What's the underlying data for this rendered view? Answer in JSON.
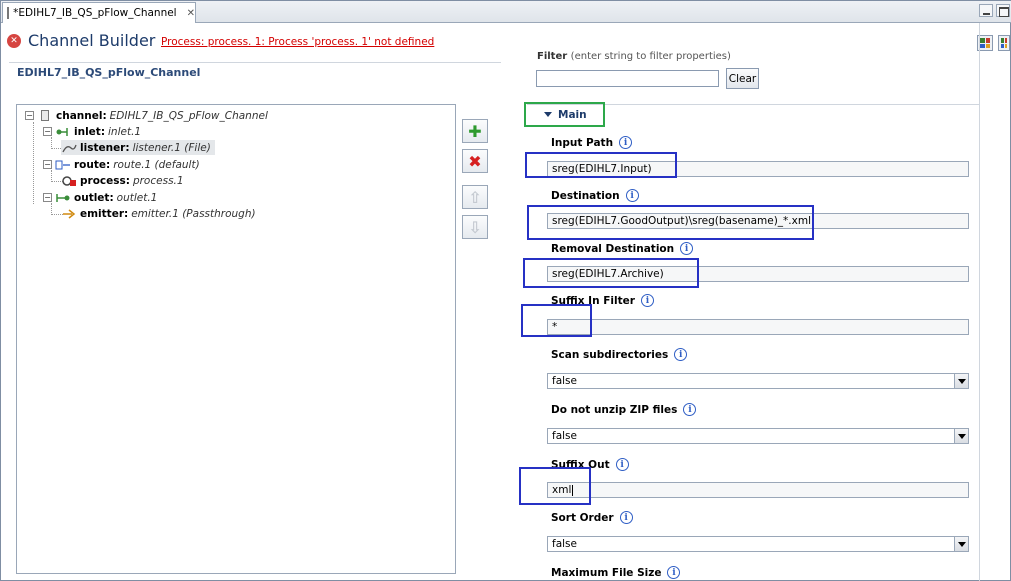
{
  "tab": {
    "title": "*EDIHL7_IB_QS_pFlow_Channel"
  },
  "header": {
    "title": "Channel Builder",
    "error_message": "Process: process. 1: Process 'process. 1' not defined"
  },
  "channel_name": "EDIHL7_IB_QS_pFlow_Channel",
  "tree": [
    {
      "label": "channel:",
      "value": "EDIHL7_IB_QS_pFlow_Channel"
    },
    {
      "label": "inlet:",
      "value": "inlet.1"
    },
    {
      "label": "listener:",
      "value": "listener.1 (File)"
    },
    {
      "label": "route:",
      "value": "route.1 (default)"
    },
    {
      "label": "process:",
      "value": "process.1"
    },
    {
      "label": "outlet:",
      "value": "outlet.1"
    },
    {
      "label": "emitter:",
      "value": "emitter.1 (Passthrough)"
    }
  ],
  "filter": {
    "label": "Filter",
    "hint": "(enter string to filter properties)",
    "value": "",
    "clear_label": "Clear"
  },
  "section": {
    "label": "Main"
  },
  "properties": [
    {
      "label": "Input Path",
      "value": "sreg(EDIHL7.Input)"
    },
    {
      "label": "Destination",
      "value": "sreg(EDIHL7.GoodOutput)\\sreg(basename)_*.xml"
    },
    {
      "label": "Removal Destination",
      "value": "sreg(EDIHL7.Archive)"
    },
    {
      "label": "Suffix In Filter",
      "value": "*"
    },
    {
      "label": "Scan subdirectories",
      "value": "false"
    },
    {
      "label": "Do not unzip ZIP files",
      "value": "false"
    },
    {
      "label": "Suffix Out",
      "value": "xml"
    },
    {
      "label": "Sort Order",
      "value": "false"
    },
    {
      "label": "Maximum File Size",
      "value": ""
    }
  ],
  "colors": {
    "highlight_blue": "#2631c4",
    "highlight_green": "#2da84a",
    "error_red": "#d40000"
  }
}
